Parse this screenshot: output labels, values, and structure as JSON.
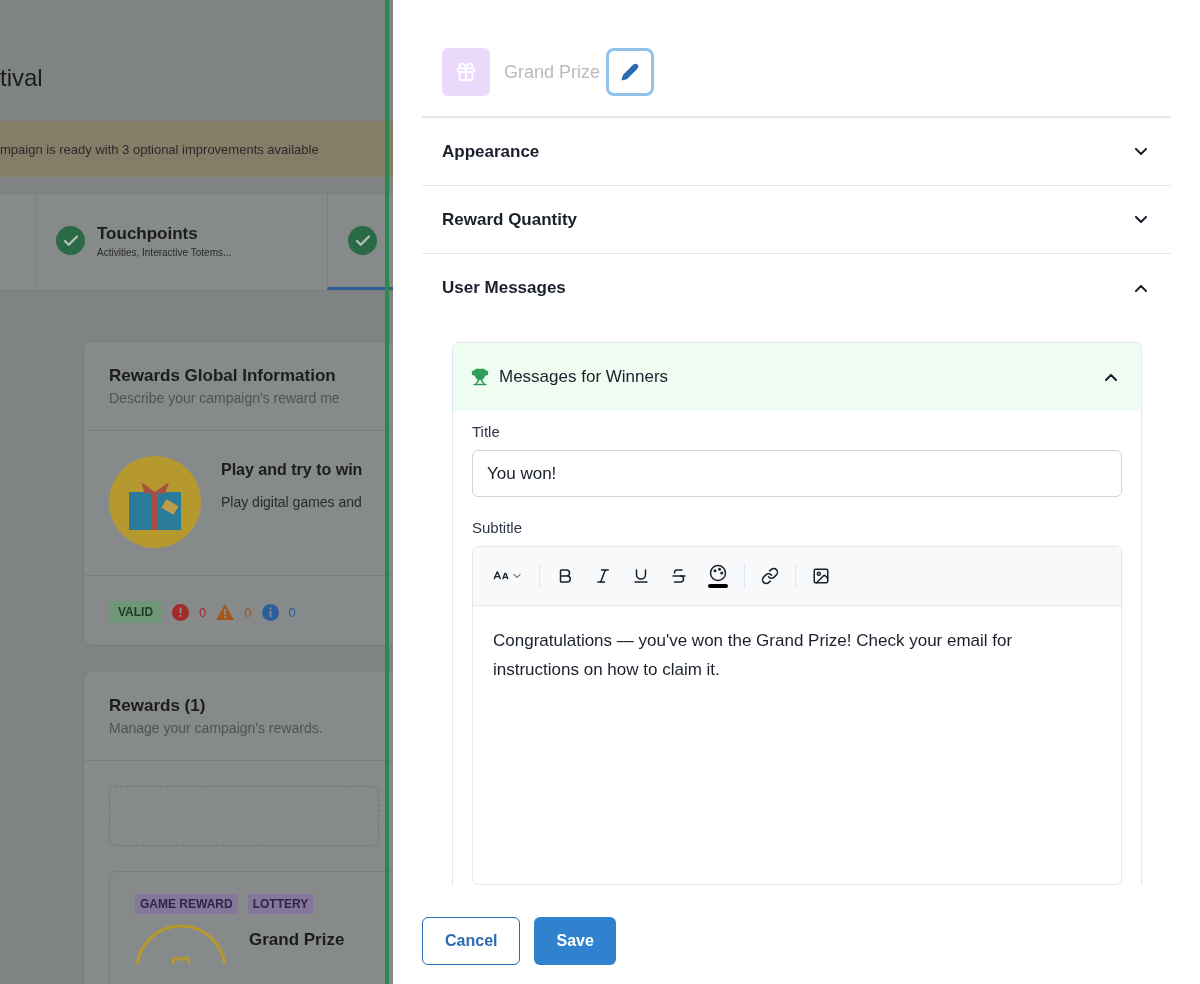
{
  "background_page": {
    "title": "tival",
    "banner": "mpaign is ready with 3 optional improvements available",
    "steps": [
      {
        "title": "Touchpoints",
        "subtitle": "Activities, Interactive Totems...",
        "complete": true,
        "selected": false
      },
      {
        "complete": true,
        "selected": true
      }
    ],
    "global_info": {
      "title": "Rewards Global Information",
      "subtitle": "Describe your campaign's reward me",
      "heading": "Play and try to win",
      "description": "Play digital games and",
      "status": "VALID",
      "counts": [
        {
          "kind": "error",
          "value": "0"
        },
        {
          "kind": "warning",
          "value": "0"
        },
        {
          "kind": "info",
          "value": "0"
        }
      ]
    },
    "rewards": {
      "title": "Rewards (1)",
      "subtitle": "Manage your campaign's rewards.",
      "items": [
        {
          "tags": [
            "GAME REWARD",
            "LOTTERY"
          ],
          "name": "Grand Prize"
        }
      ]
    }
  },
  "drawer": {
    "reward_name": "Grand Prize",
    "sections": [
      {
        "title": "Appearance",
        "expanded": false
      },
      {
        "title": "Reward Quantity",
        "expanded": false
      },
      {
        "title": "User Messages",
        "expanded": true
      }
    ],
    "messages": {
      "title": "Messages for Winners",
      "expanded": true,
      "title_label": "Title",
      "title_value": "You won!",
      "subtitle_label": "Subtitle",
      "subtitle_value": "Congratulations — you've won the Grand Prize! Check your email for instructions on how to claim it."
    },
    "buttons": {
      "cancel": "Cancel",
      "save": "Save"
    }
  }
}
